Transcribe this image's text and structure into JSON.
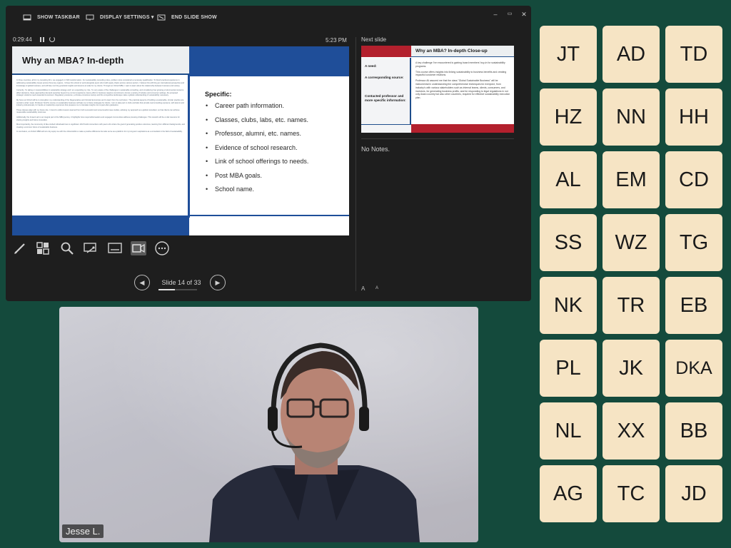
{
  "toolbar": {
    "show_taskbar": "SHOW TASKBAR",
    "display_settings": "DISPLAY SETTINGS ▾",
    "end_slide_show": "END SLIDE SHOW"
  },
  "window_controls": {
    "minimize": "–",
    "restore": "▭",
    "close": "✕"
  },
  "timer": "0:29:44",
  "clock": "5:23 PM",
  "current_slide": {
    "title": "Why an MBA? In-depth",
    "body_paragraphs": [
      "In three countries, all for my consulting firm, we engaged in CSR transformation. For sustainability consulting roles, problem sizes considered a necessary qualification. To blend practical experience in addressing sustainability issues across three key regions, I chose this school to work alongside peers who build supply chains across various sectors. I believe this will bring an international perspective and knowledge of global business, and will help me bring practical insights and lessons at scale for my clients. Through an Oxford MBA, I want to learn about the relationship between business and society.",
      "Currently, I'm taking on responsibilities in sustainable strategy and I am expanding my role. I'm very aware of the challenges in sustainable consulting, and considering how growing environmental concerns affect decisions, these approaches demand expertise beyond my current experience. Every effort in business requires commitment. Across a variety of industry and consumer settings, the proposed strategic solutions need expanded investment. Regulatory pressures, a climate-conscious society and this competitive landscape make a global understanding of sustainability necessary.",
      "My focus at Oxford will be to strengthen my understanding of the Regenerative and Circular Economies and to learn from the curriculum. The practical aspects of building a sustainable, circular practice are central to what I seek. Professor Smith's course on sustainable business will help me to frame strategies for clients. I aim to take part in clubs and labs that provide real consulting exposure, with alumni and industry professionals, for hands-on leadership experience that prepares me to translate insights into impact after graduation.",
      "These classes align with my future role. I intend to utilize lessons learned from both successful and unsuccessful case studies, advising my approach as a global consultant, so that clients can achieve measurable sustainability outcomes.",
      "Additionally, the Impact Lab is an integral part of the MBA journey. It highlights how responsible leaders and engaged communities address pressing challenges. This network will be a vital resource for sharing insights and future innovation.",
      "Most importantly, the community of like-minded individuals here is significant. We'll build connections with peers who share the goal of generating positive outcomes, learning from different backgrounds, and creating a common future of sustainable business.",
      "In conclusion, an Oxford MBA will not only equip me with the critical skills to make a positive difference but also serve as a platform for my long-term aspirations as a consultant in the field of sustainability."
    ],
    "specific_title": "Specific:",
    "specific_items": [
      "Career path information.",
      "Classes, clubs, labs, etc. names.",
      "Professor, alumni, etc. names.",
      "Evidence of school research.",
      "Link of school offerings to needs.",
      "Post MBA goals.",
      "School name."
    ]
  },
  "navigation": {
    "slide_counter": "Slide 14 of 33",
    "current": 14,
    "total": 33,
    "progress": 0.42
  },
  "next_slide": {
    "label": "Next slide",
    "title": "Why an MBA? In-depth Close-up",
    "labels": [
      "A need:",
      "A corresponding source:",
      "Contacted professor and more specific information:"
    ],
    "body_paragraphs": [
      "A key challenge I've encountered is gaining board members' buy-in for sustainability programs.",
      "This course offers insights into linking sustainability to business benefits and creating impactful customer relations.",
      "Professor Ali assured me that the class \"Global Sustainable Business\" will be instrumental in understanding the comprehensive techniques for everyone, from industry's with various stakeholders such as internal teams, clients, consumers, and investors, for generating business profits, and for responding to legal regulations in not only Asian country but also other countries, required for effective sustainability execution plan."
    ]
  },
  "notes": "No Notes.",
  "font_controls": {
    "increase": "A",
    "decrease": "A"
  },
  "speaker": {
    "name": "Jesse L."
  },
  "participants": [
    "JT",
    "AD",
    "TD",
    "HZ",
    "NN",
    "HH",
    "AL",
    "EM",
    "CD",
    "SS",
    "WZ",
    "TG",
    "NK",
    "TR",
    "EB",
    "PL",
    "JK",
    "DKA",
    "NL",
    "XX",
    "BB",
    "AG",
    "TC",
    "JD"
  ],
  "colors": {
    "background": "#144a3c",
    "tile": "#f6e4c4",
    "slide_blue": "#1f4e99",
    "slide_red": "#b3202d"
  },
  "icons": {
    "tools": [
      "pen-icon",
      "all-slides-icon",
      "zoom-icon",
      "laser-pointer-icon",
      "subtitles-icon",
      "camera-icon",
      "more-icon"
    ]
  }
}
